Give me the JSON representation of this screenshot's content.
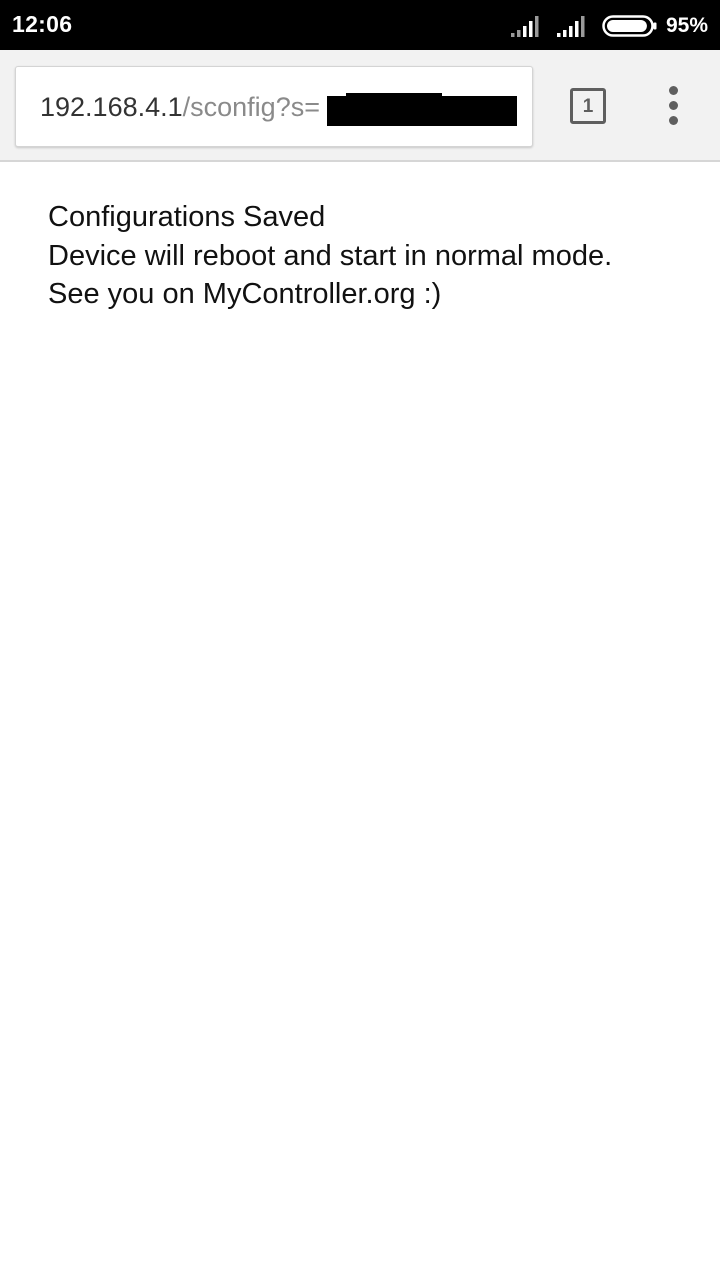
{
  "status_bar": {
    "time": "12:06",
    "battery_percent": "95%",
    "battery_level": 0.95,
    "icons": [
      "signal-icon",
      "signal-icon",
      "battery-icon"
    ]
  },
  "browser": {
    "url_host": "192.168.4.1",
    "url_path": "/sconfig?s=",
    "tab_count": "1",
    "icons": [
      "tab-switcher-icon",
      "overflow-menu-icon"
    ]
  },
  "page": {
    "lines": [
      "Configurations Saved",
      "Device will reboot and start in normal mode.",
      "See you on MyController.org :)"
    ]
  },
  "colors": {
    "status_bar_bg": "#000000",
    "toolbar_bg": "#f2f2f2",
    "url_host_text": "#333333",
    "url_path_text": "#8a8a8a",
    "icon_gray": "#5f5f5f",
    "page_text": "#111111"
  }
}
